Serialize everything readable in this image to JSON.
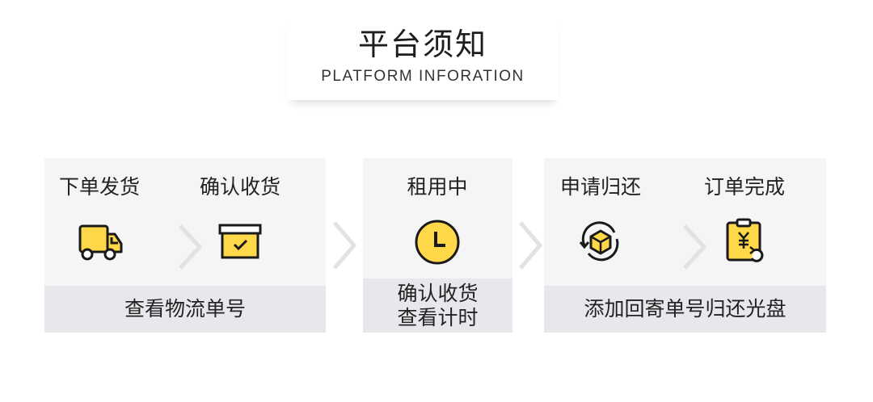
{
  "header": {
    "title_zh": "平台须知",
    "title_en": "PLATFORM INFORATION"
  },
  "panels": [
    {
      "steps": [
        {
          "label": "下单发货",
          "icon": "truck-icon"
        },
        {
          "label": "确认收货",
          "icon": "box-icon"
        }
      ],
      "bar": "查看物流单号"
    },
    {
      "steps": [
        {
          "label": "租用中",
          "icon": "clock-icon"
        }
      ],
      "bar_line1": "确认收货",
      "bar_line2": "查看计时"
    },
    {
      "steps": [
        {
          "label": "申请归还",
          "icon": "return-cube-icon"
        },
        {
          "label": "订单完成",
          "icon": "refund-clipboard-icon"
        }
      ],
      "bar": "添加回寄单号归还光盘"
    }
  ],
  "colors": {
    "accent": "#ffd84a",
    "stroke": "#1a1a1a",
    "panel": "#f5f5f5",
    "bar": "#e6e8eb",
    "chevron": "#e2e2e2"
  }
}
